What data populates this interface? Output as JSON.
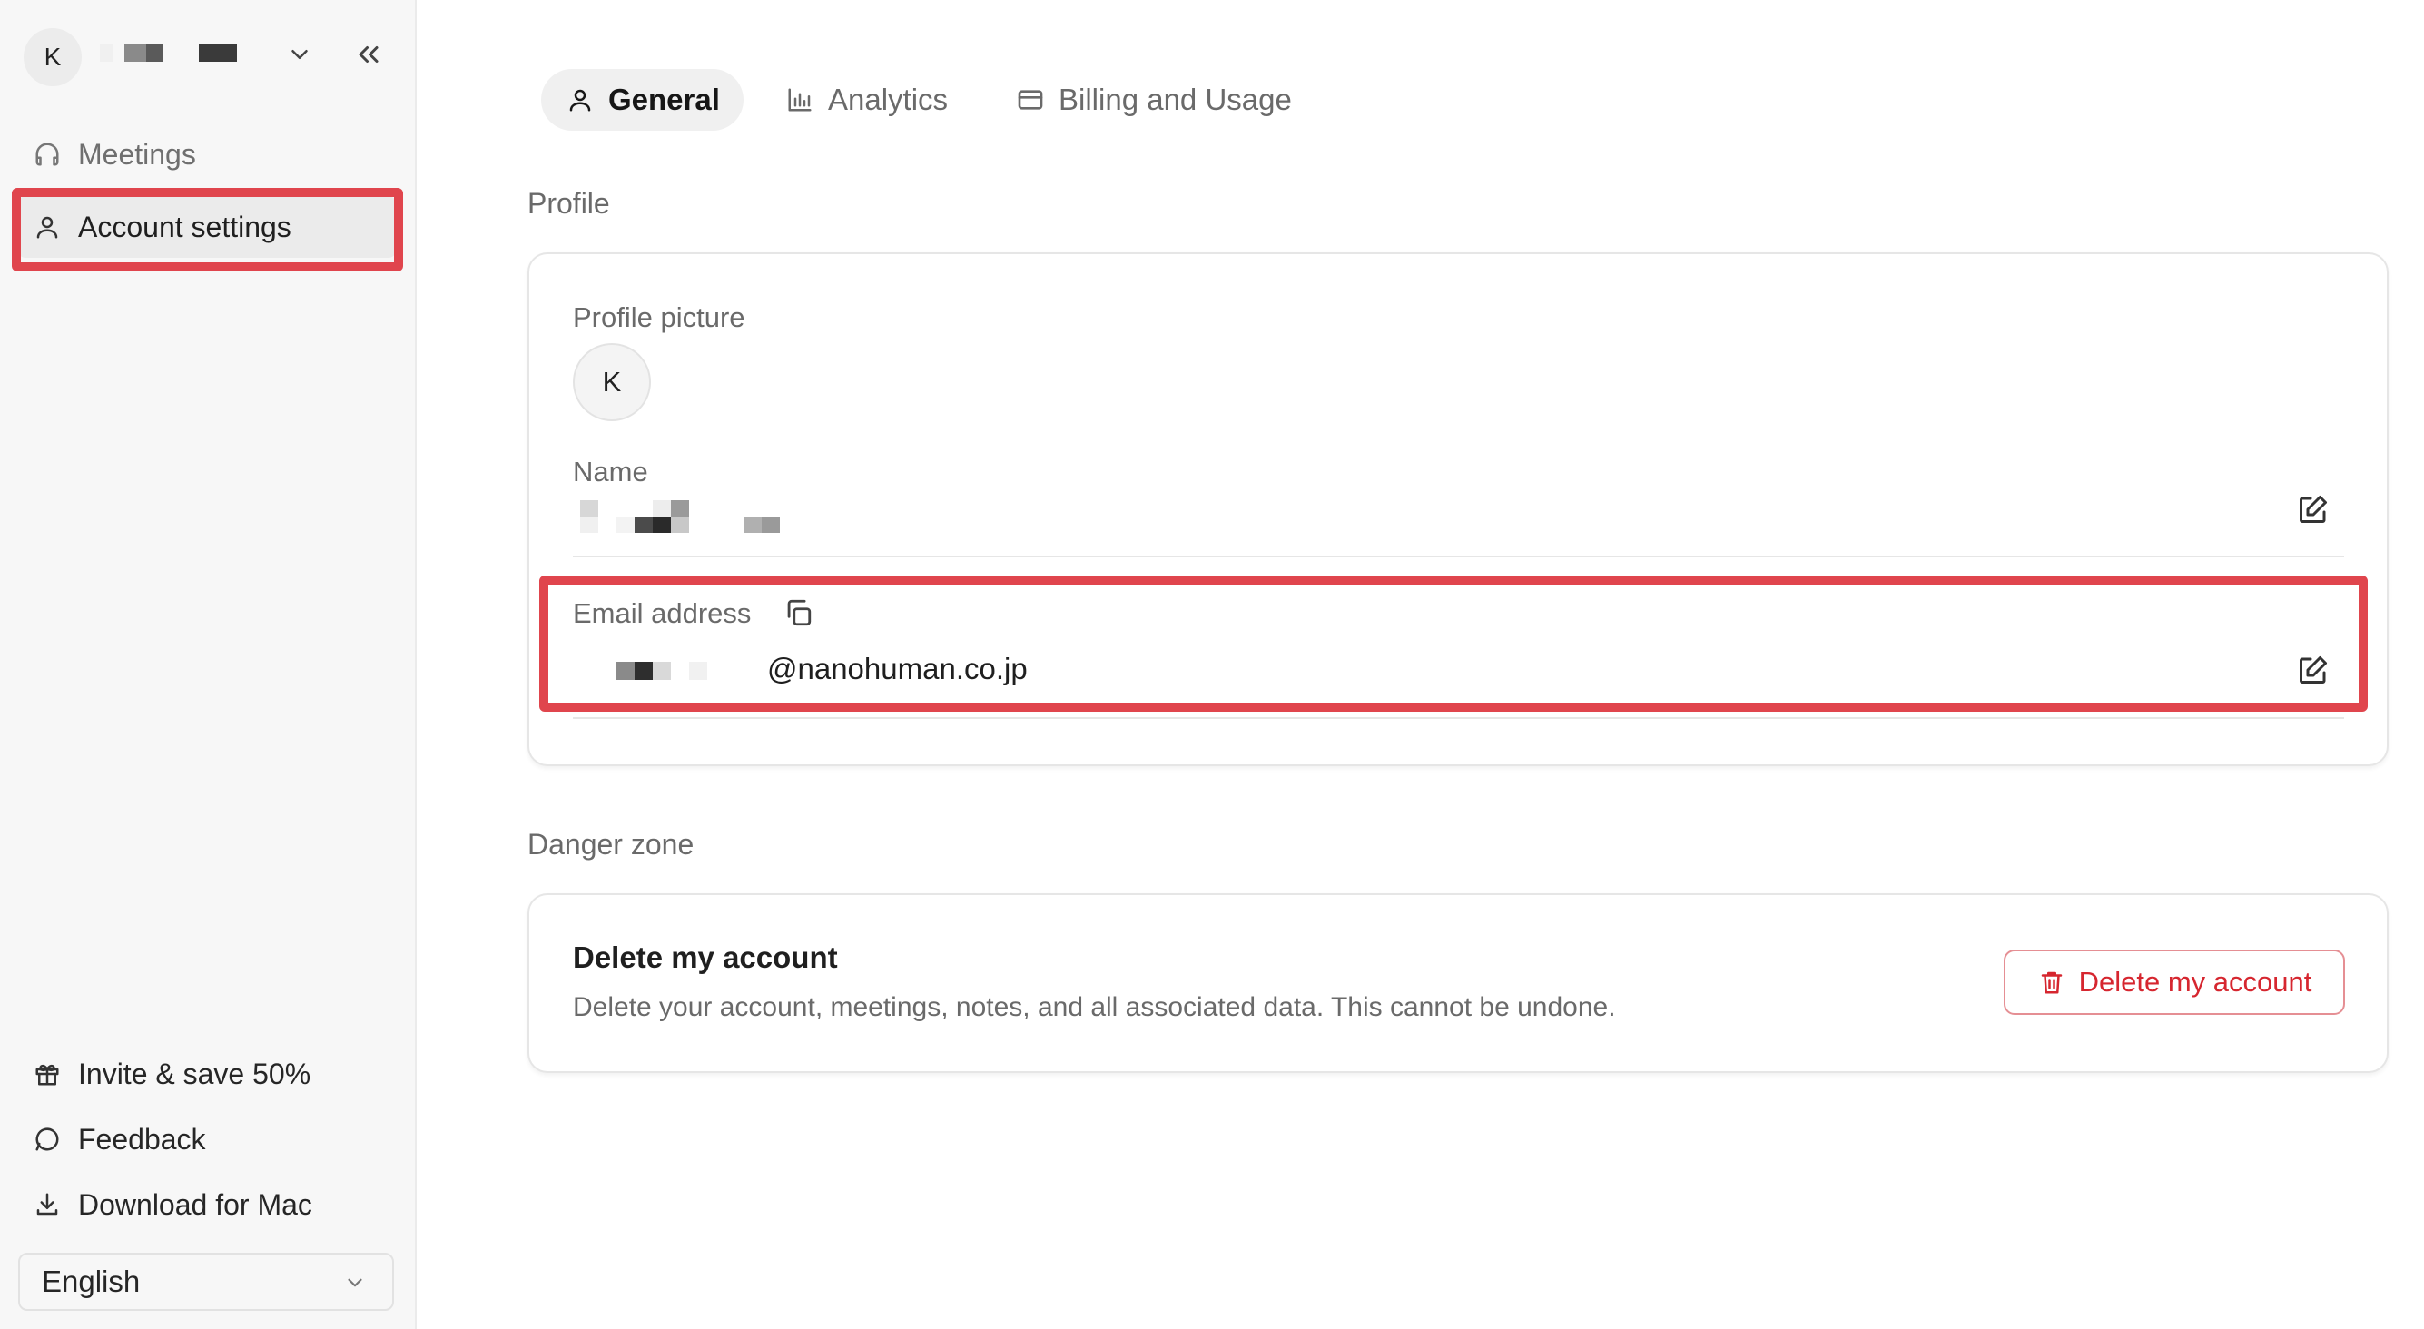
{
  "sidebar": {
    "workspace": {
      "avatar_initial": "K"
    },
    "nav": [
      {
        "label": "Meetings",
        "icon": "headphones-icon"
      },
      {
        "label": "Account settings",
        "icon": "user-icon",
        "active": true
      }
    ],
    "footer": [
      {
        "label": "Invite & save 50%",
        "icon": "gift-icon"
      },
      {
        "label": "Feedback",
        "icon": "message-circle-icon"
      },
      {
        "label": "Download for Mac",
        "icon": "download-icon"
      }
    ],
    "language": {
      "selected": "English"
    }
  },
  "tabs": [
    {
      "label": "General",
      "icon": "user-icon",
      "active": true
    },
    {
      "label": "Analytics",
      "icon": "bar-chart-icon"
    },
    {
      "label": "Billing and Usage",
      "icon": "credit-card-icon"
    }
  ],
  "profile": {
    "section_title": "Profile",
    "picture_label": "Profile picture",
    "avatar_initial": "K",
    "name_label": "Name",
    "email_label": "Email address",
    "email_domain": "@nanohuman.co.jp"
  },
  "danger": {
    "section_title": "Danger zone",
    "title": "Delete my account",
    "description": "Delete your account, meetings, notes, and all associated data. This cannot be undone.",
    "button_label": "Delete my account"
  },
  "colors": {
    "highlight": "#e0454d",
    "danger": "#d6262f",
    "sidebar_bg": "#f7f7f7"
  }
}
